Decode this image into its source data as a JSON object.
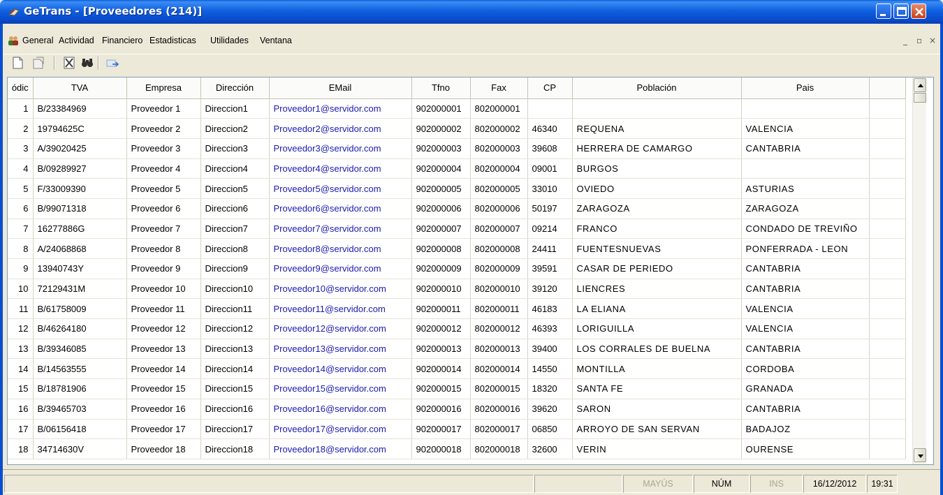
{
  "window": {
    "title": "GeTrans - [Proveedores (214)]"
  },
  "menu": {
    "items": [
      {
        "label": "General"
      },
      {
        "label": "Actividad"
      },
      {
        "label": "Financiero"
      },
      {
        "label": "Estadisticas"
      },
      {
        "label": "Utilidades"
      },
      {
        "label": "Ventana"
      }
    ],
    "mdi_min": "_",
    "mdi_restore": "▫",
    "mdi_close": "×"
  },
  "toolbar": {
    "icons": [
      "new-document-icon",
      "properties-icon",
      "delete-icon",
      "find-icon",
      "export-icon"
    ]
  },
  "grid": {
    "columns": [
      "ódic",
      "TVA",
      "Empresa",
      "Dirección",
      "EMail",
      "Tfno",
      "Fax",
      "CP",
      "Población",
      "Pais",
      ""
    ],
    "rows": [
      [
        "1",
        "B/23384969",
        "Proveedor 1",
        "Direccion1",
        "Proveedor1@servidor.com",
        "902000001",
        "802000001",
        "",
        "",
        ""
      ],
      [
        "2",
        "19794625C",
        "Proveedor 2",
        "Direccion2",
        "Proveedor2@servidor.com",
        "902000002",
        "802000002",
        "46340",
        "REQUENA",
        "VALENCIA"
      ],
      [
        "3",
        "A/39020425",
        "Proveedor 3",
        "Direccion3",
        "Proveedor3@servidor.com",
        "902000003",
        "802000003",
        "39608",
        "HERRERA DE CAMARGO",
        "CANTABRIA"
      ],
      [
        "4",
        "B/09289927",
        "Proveedor 4",
        "Direccion4",
        "Proveedor4@servidor.com",
        "902000004",
        "802000004",
        "09001",
        "BURGOS",
        ""
      ],
      [
        "5",
        "F/33009390",
        "Proveedor 5",
        "Direccion5",
        "Proveedor5@servidor.com",
        "902000005",
        "802000005",
        "33010",
        "OVIEDO",
        "ASTURIAS"
      ],
      [
        "6",
        "B/99071318",
        "Proveedor 6",
        "Direccion6",
        "Proveedor6@servidor.com",
        "902000006",
        "802000006",
        "50197",
        "ZARAGOZA",
        "ZARAGOZA"
      ],
      [
        "7",
        "16277886G",
        "Proveedor 7",
        "Direccion7",
        "Proveedor7@servidor.com",
        "902000007",
        "802000007",
        "09214",
        "FRANCO",
        "CONDADO DE TREVIÑO"
      ],
      [
        "8",
        "A/24068868",
        "Proveedor 8",
        "Direccion8",
        "Proveedor8@servidor.com",
        "902000008",
        "802000008",
        "24411",
        "FUENTESNUEVAS",
        "PONFERRADA - LEON"
      ],
      [
        "9",
        "13940743Y",
        "Proveedor 9",
        "Direccion9",
        "Proveedor9@servidor.com",
        "902000009",
        "802000009",
        "39591",
        "CASAR DE PERIEDO",
        "CANTABRIA"
      ],
      [
        "10",
        "72129431M",
        "Proveedor 10",
        "Direccion10",
        "Proveedor10@servidor.com",
        "902000010",
        "802000010",
        "39120",
        "LIENCRES",
        "CANTABRIA"
      ],
      [
        "11",
        "B/61758009",
        "Proveedor 11",
        "Direccion11",
        "Proveedor11@servidor.com",
        "902000011",
        "802000011",
        "46183",
        "LA ELIANA",
        "VALENCIA"
      ],
      [
        "12",
        "B/46264180",
        "Proveedor 12",
        "Direccion12",
        "Proveedor12@servidor.com",
        "902000012",
        "802000012",
        "46393",
        "LORIGUILLA",
        "VALENCIA"
      ],
      [
        "13",
        "B/39346085",
        "Proveedor 13",
        "Direccion13",
        "Proveedor13@servidor.com",
        "902000013",
        "802000013",
        "39400",
        "LOS CORRALES DE BUELNA",
        "CANTABRIA"
      ],
      [
        "14",
        "B/14563555",
        "Proveedor 14",
        "Direccion14",
        "Proveedor14@servidor.com",
        "902000014",
        "802000014",
        "14550",
        "MONTILLA",
        "CORDOBA"
      ],
      [
        "15",
        "B/18781906",
        "Proveedor 15",
        "Direccion15",
        "Proveedor15@servidor.com",
        "902000015",
        "802000015",
        "18320",
        "SANTA FE",
        "GRANADA"
      ],
      [
        "16",
        "B/39465703",
        "Proveedor 16",
        "Direccion16",
        "Proveedor16@servidor.com",
        "902000016",
        "802000016",
        "39620",
        "SARON",
        "CANTABRIA"
      ],
      [
        "17",
        "B/06156418",
        "Proveedor 17",
        "Direccion17",
        "Proveedor17@servidor.com",
        "902000017",
        "802000017",
        "06850",
        "ARROYO DE SAN SERVAN",
        "BADAJOZ"
      ],
      [
        "18",
        "34714630V",
        "Proveedor 18",
        "Direccion18",
        "Proveedor18@servidor.com",
        "902000018",
        "802000018",
        "32600",
        "VERIN",
        "OURENSE"
      ]
    ]
  },
  "statusbar": {
    "mayus": "MAYÚS",
    "num": "NÚM",
    "ins": "INS",
    "date": "16/12/2012",
    "time": "19:31"
  }
}
